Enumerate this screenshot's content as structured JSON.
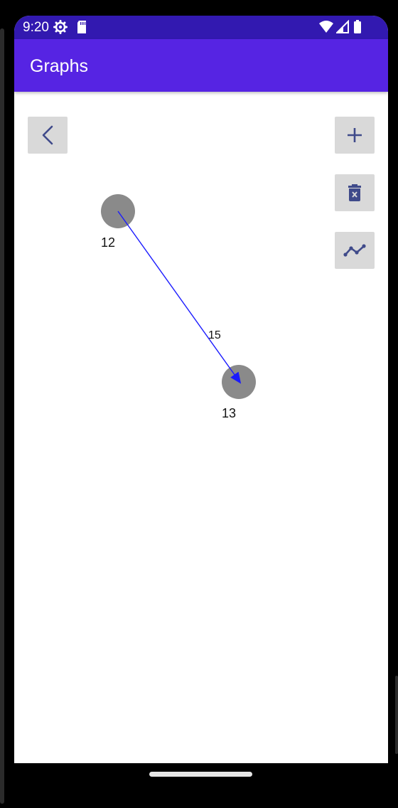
{
  "status_bar": {
    "time": "9:20",
    "icons": [
      "settings-icon",
      "sd-card-icon",
      "wifi-icon",
      "signal-icon",
      "battery-icon"
    ]
  },
  "app_bar": {
    "title": "Graphs"
  },
  "toolbar": {
    "back": "chevron-left-icon",
    "add": "plus-icon",
    "delete": "trash-icon",
    "graph": "line-graph-icon"
  },
  "graph": {
    "nodes": [
      {
        "id": "12",
        "label": "12"
      },
      {
        "id": "13",
        "label": "13"
      }
    ],
    "edges": [
      {
        "from": "12",
        "to": "13",
        "weight": "15",
        "color": "#1a1aff",
        "directed": true
      }
    ],
    "node_color": "#8a8a8a"
  },
  "colors": {
    "status_bar": "#3219b0",
    "app_bar": "#5624e3",
    "button_bg": "#d9d9d9",
    "icon": "#3f4a8a"
  }
}
